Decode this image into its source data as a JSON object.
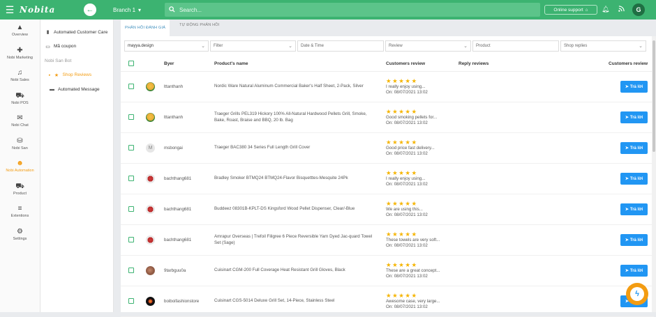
{
  "topbar": {
    "logo": "Nobita",
    "branch": "Branch 1",
    "search_placeholder": "Search...",
    "online_support": "Online support",
    "user_initial": "G",
    "accent_color": "#3cb371"
  },
  "leftnav": [
    {
      "label": "Overview",
      "icon": "mountain-icon"
    },
    {
      "label": "Nobi Marketing",
      "icon": "gamepad-icon"
    },
    {
      "label": "Nobi Sales",
      "icon": "headset-icon"
    },
    {
      "label": "Nobi POS",
      "icon": "cart-icon"
    },
    {
      "label": "Nobi Chat",
      "icon": "chat-icon"
    },
    {
      "label": "Nobi San",
      "icon": "basket-icon"
    },
    {
      "label": "Nobi Automation",
      "icon": "robot-icon",
      "active": true
    },
    {
      "label": "Product",
      "icon": "truck-icon"
    },
    {
      "label": "Extentions",
      "icon": "list-icon"
    },
    {
      "label": "Settings",
      "icon": "gear-icon"
    }
  ],
  "subnav": {
    "items": [
      {
        "label": "Automated Customer Care",
        "icon": "phone-icon"
      },
      {
        "label": "Mã coupon",
        "icon": "ticket-icon"
      },
      {
        "label": "Nobi San Bot",
        "icon": ""
      },
      {
        "label": "Shop Reviews",
        "icon": "star-icon",
        "active": true
      },
      {
        "label": "Automated Message",
        "icon": "message-icon"
      }
    ]
  },
  "tabs": [
    "PHẢN HỒI ĐÁNH GIÁ",
    "TỰ ĐỘNG PHẢN HỒI"
  ],
  "filters": {
    "shop": "mayya.design",
    "filter": "Filter",
    "datetime": "Date & Time",
    "review": "Review",
    "product": "Product",
    "shop_replies": "Shop replies"
  },
  "table": {
    "headers": {
      "buyer": "Byer",
      "product": "Product's name",
      "review": "Customers review",
      "reply": "Reply reviews",
      "action": "Customers review"
    },
    "reply_label": "Trả lời",
    "stars": "★★★★★",
    "rows": [
      {
        "buyer": "lttanthanh",
        "avatar": "yellow",
        "product": "Nordic Ware Natural Aluminum Commercial Baker's Half Sheet, 2-Pack, Silver",
        "review": "I really enjoy using...",
        "date": "On: 08/07/2021 13:02"
      },
      {
        "buyer": "lttanthanh",
        "avatar": "yellow",
        "product": "Traeger Grills PEL319 Hickory 100% All-Natural Hardwood Pellets Grill, Smoke, Bake, Roast, Braise and BBQ, 20 lb. Bag",
        "review": "Good smoking pellets for...",
        "date": "On: 08/07/2021 13:02"
      },
      {
        "buyer": "msbongai",
        "avatar": "m",
        "avatar_letter": "M",
        "product": "Traeger BAC380 34 Series Full Length Grill Cover",
        "review": "Good price fast delivery...",
        "date": "On: 08/07/2021 13:02"
      },
      {
        "buyer": "bachthang681",
        "avatar": "red",
        "product": "Bradley Smoker BTMQ24 BTMQ24-Flavor Bisquetttes-Mesquite 24Pk",
        "review": "I really enjoy using...",
        "date": "On: 08/07/2021 13:02"
      },
      {
        "buyer": "bachthang681",
        "avatar": "red",
        "product": "Buddeez 08301B-KPLT-DS Kingsford Wood Pellet Dispenser, Clear/-Blue",
        "review": "We are using this...",
        "date": "On: 08/07/2021 13:02"
      },
      {
        "buyer": "bachthang681",
        "avatar": "red",
        "product": "Amrapur Overseas | Trefoil Filigree 6 Piece Reversible Yarn Dyed Jac-quard Towel Set (Sage)",
        "review": "These towels are very soft...",
        "date": "On: 08/07/2021 13:02"
      },
      {
        "buyer": "9tarbguu0a",
        "avatar": "food",
        "product": "Cuisinart CGM-200 Full Coverage Heat Resistant Grill Gloves, Black",
        "review": "These are a great concept...",
        "date": "On: 08/07/2021 13:02"
      },
      {
        "buyer": "boiboifashionstore",
        "avatar": "black",
        "product": "Cuisinart CGS-5014 Deluxe Grill Set, 14-Piece, Stainless Steel",
        "review": "Awesome case, very large...",
        "date": "On: 08/07/2021 13:02"
      }
    ]
  }
}
